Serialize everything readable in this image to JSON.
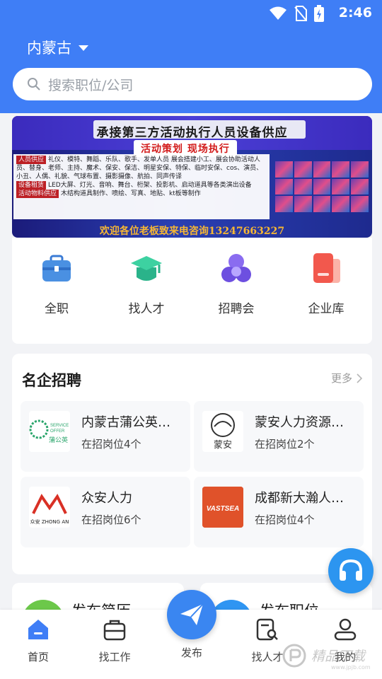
{
  "status_bar": {
    "time": "2:46",
    "icons": [
      "wifi-icon",
      "no-sim-icon",
      "battery-charging-icon"
    ]
  },
  "header": {
    "city": "内蒙古",
    "search_placeholder": "搜索职位/公司"
  },
  "banner": {
    "title": "承接第三方活动执行人员设备供应",
    "subtitle": "活动策划    现场执行",
    "sections": [
      {
        "tag": "人员供应",
        "text": "礼仪、模特、舞蹈、乐队、歌手、发单人员 展会搭建小工、展会协助活动人员、替身、老师、主持、魔术、保安、保洁、明星安保、特保、临时安保、cos、演员、小丑、人偶、礼貌、气球布置、摄影摄像、航拍、同声传译"
      },
      {
        "tag": "设备租赁",
        "text": "LED大屏、灯光、音响、舞台、桁架、投影机、启动道具等各类演出设备"
      },
      {
        "tag": "活动物料供应",
        "text": "木结构道具制作、喷绘、写真、地贴、kt板等制作"
      }
    ],
    "footer": "欢迎各位老板致来电咨询13247663227"
  },
  "categories": [
    {
      "label": "全职",
      "icon": "briefcase-icon"
    },
    {
      "label": "找人才",
      "icon": "graduation-cap-icon"
    },
    {
      "label": "招聘会",
      "icon": "fair-icon"
    },
    {
      "label": "企业库",
      "icon": "company-card-icon"
    }
  ],
  "famous": {
    "title": "名企招聘",
    "more": "更多",
    "companies": [
      {
        "name": "内蒙古蒲公英服务有限公司",
        "count": "在招岗位4个",
        "logo_text": "蒲公英"
      },
      {
        "name": "蒙安人力资源服务有限公司",
        "count": "在招岗位2个",
        "logo_text": "蒙安"
      },
      {
        "name": "众安人力",
        "count": "在招岗位6个",
        "logo_text": "众安 ZHONG AN"
      },
      {
        "name": "成都新大瀚人力资源",
        "count": "在招岗位4个",
        "logo_text": "VASTSEA"
      }
    ]
  },
  "quick_actions": [
    {
      "label": "发布简历",
      "color": "#6cc84a"
    },
    {
      "label": "发布职位",
      "color": "#2f95f2"
    }
  ],
  "tabbar": {
    "items": [
      {
        "label": "首页",
        "icon": "home-icon"
      },
      {
        "label": "找工作",
        "icon": "briefcase-outline-icon"
      },
      {
        "label": "发布",
        "icon": "paper-plane-icon"
      },
      {
        "label": "找人才",
        "icon": "resume-search-icon"
      },
      {
        "label": "我的",
        "icon": "user-icon"
      }
    ]
  },
  "watermark": {
    "text": "精品下载",
    "url_text": "www.jpjb.com"
  },
  "colors": {
    "primary": "#3f7ef6",
    "accent_publish": "#3a86f1",
    "headset": "#2c95f0"
  }
}
